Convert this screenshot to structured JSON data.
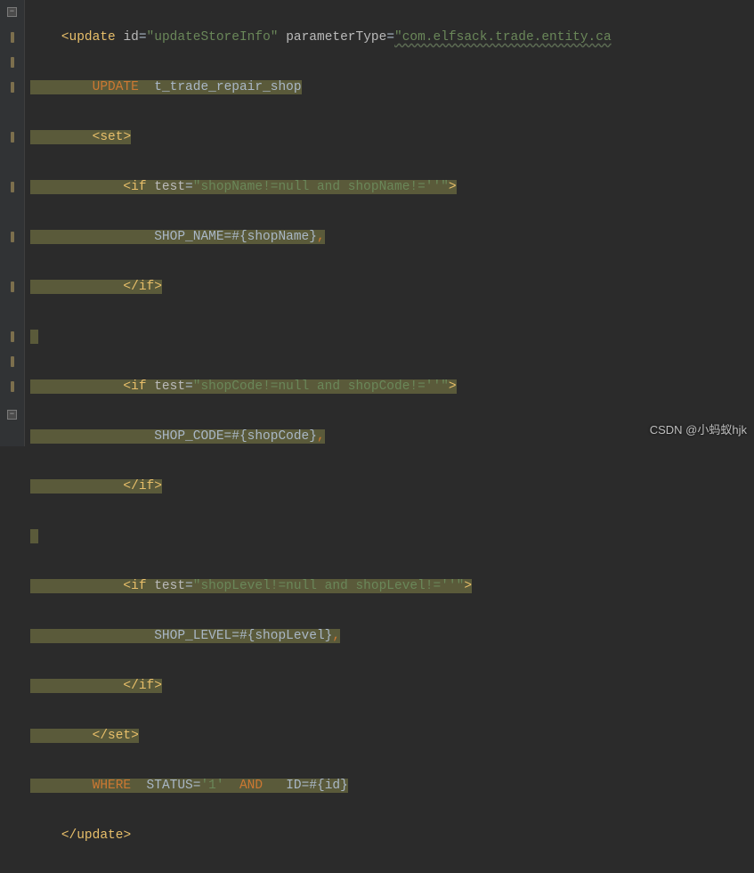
{
  "code": {
    "tag_update": "update",
    "attr_id": "id",
    "val_id": "\"updateStoreInfo\"",
    "attr_param": "parameterType",
    "val_param": "\"com.elfsack.trade.entity.ca",
    "kw_update": "UPDATE",
    "table": "t_trade_repair_shop",
    "tag_set": "set",
    "tag_if": "if",
    "attr_test": "test",
    "test1": "\"shopName!=null and shopName!=''\"",
    "body1a": "SHOP_NAME=#{shopName}",
    "comma": ",",
    "close_if": "/if",
    "test2": "\"shopCode!=null and shopCode!=''\"",
    "body2a": "SHOP_CODE=#{shopCode}",
    "test3": "\"shopLevel!=null and shopLevel!=''\"",
    "body3a": "SHOP_LEVEL=#{shopLevel}",
    "close_set": "/set",
    "kw_where": "WHERE",
    "status": "STATUS=",
    "one": "'1'",
    "kw_and": "AND",
    "id_eq": "ID=#{id}",
    "close_update": "/update"
  },
  "watermark": "CSDN @小蚂蚁hjk"
}
